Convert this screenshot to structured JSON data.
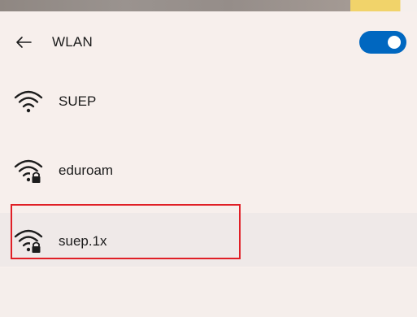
{
  "header": {
    "title": "WLAN",
    "back_icon": "arrow-left-icon",
    "toggle_state": "on"
  },
  "networks": [
    {
      "name": "SUEP",
      "icon": "wifi-icon",
      "secured": false
    },
    {
      "name": "eduroam",
      "icon": "wifi-locked-icon",
      "secured": true
    },
    {
      "name": "suep.1x",
      "icon": "wifi-locked-icon",
      "secured": true,
      "highlighted": true
    }
  ],
  "colors": {
    "accent": "#0067c0",
    "highlight_box": "#e01f26",
    "background": "#f7efec"
  }
}
